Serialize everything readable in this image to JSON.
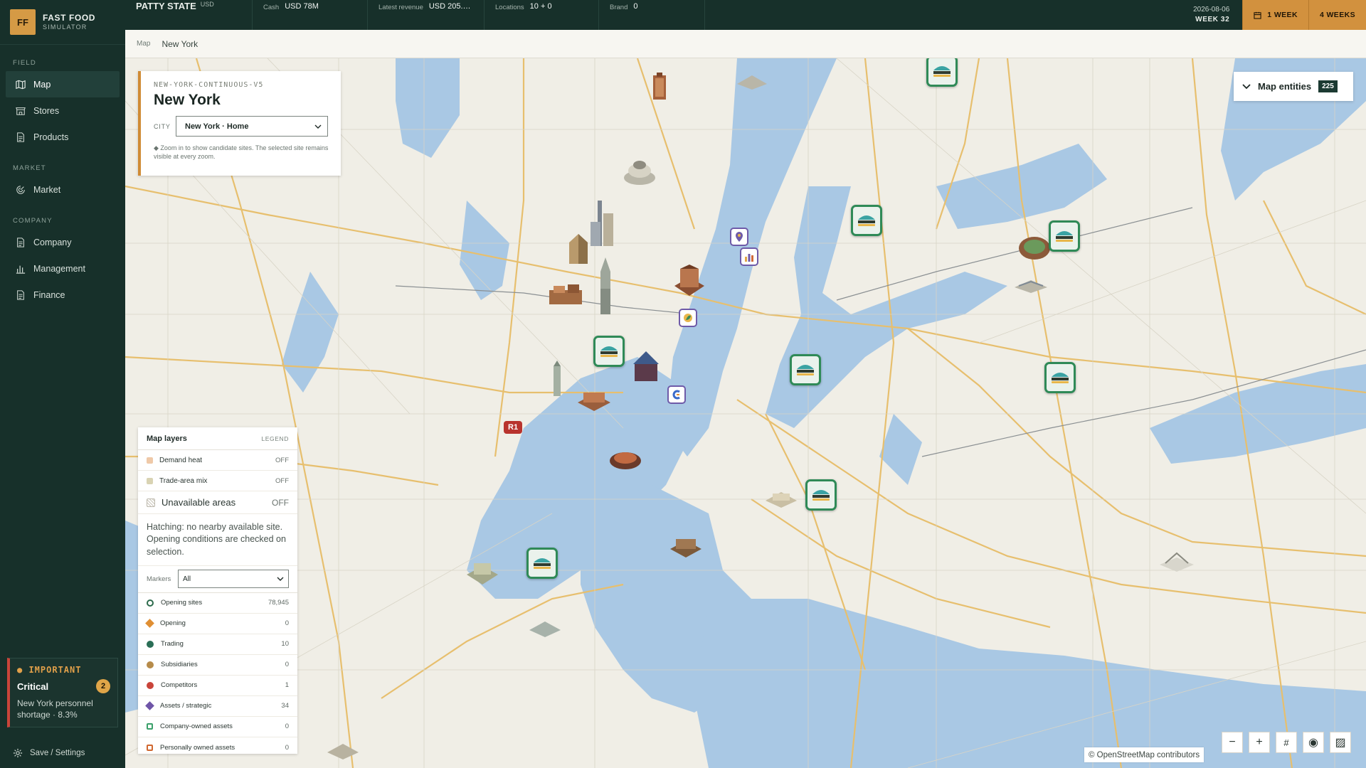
{
  "brand": {
    "logo": "FF",
    "name": "FAST FOOD",
    "sub": "SIMULATOR"
  },
  "sidebar": {
    "sections": [
      {
        "title": "FIELD",
        "items": [
          {
            "label": "Map",
            "icon": "map-icon",
            "active": true
          },
          {
            "label": "Stores",
            "icon": "store-icon"
          },
          {
            "label": "Products",
            "icon": "document-icon"
          }
        ]
      },
      {
        "title": "MARKET",
        "items": [
          {
            "label": "Market",
            "icon": "radar-icon"
          }
        ]
      },
      {
        "title": "COMPANY",
        "items": [
          {
            "label": "Company",
            "icon": "document-icon"
          },
          {
            "label": "Management",
            "icon": "bar-chart-icon"
          },
          {
            "label": "Finance",
            "icon": "document-icon"
          }
        ]
      }
    ],
    "alert": {
      "tag": "IMPORTANT",
      "title": "Critical",
      "count": "2",
      "message": "New York personnel shortage · 8.3%"
    },
    "save_settings": "Save / Settings"
  },
  "topbar": {
    "company": "PATTY STATE",
    "company_unit": "USD",
    "stats": [
      {
        "label": "Cash",
        "value": "USD 78M"
      },
      {
        "label": "Latest revenue",
        "value": "USD 205.…"
      },
      {
        "label": "Locations",
        "value": "10 + 0"
      },
      {
        "label": "Brand",
        "value": "0"
      }
    ],
    "date": "2026-08-06",
    "week": "WEEK 32",
    "btn_1week": "1 WEEK",
    "btn_4weeks": "4 WEEKS"
  },
  "breadcrumb": {
    "root": "Map",
    "current": "New York"
  },
  "city_panel": {
    "code": "NEW-YORK-CONTINUOUS-V5",
    "name": "New York",
    "city_label": "CITY",
    "city_value": "New York · Home",
    "hint": "◆ Zoom in to show candidate sites. The selected site remains visible at every zoom."
  },
  "entities": {
    "label": "Map entities",
    "count": "225"
  },
  "layers": {
    "title": "Map layers",
    "legend": "LEGEND",
    "toggles": [
      {
        "label": "Demand heat",
        "state": "OFF",
        "color": "#efc9a8"
      },
      {
        "label": "Trade-area mix",
        "state": "OFF",
        "color": "#d9d3b3"
      }
    ],
    "unavailable": {
      "label": "Unavailable areas",
      "state": "OFF"
    },
    "hatch_note": "Hatching: no nearby available site. Opening conditions are checked on selection.",
    "markers_label": "Markers",
    "markers_value": "All",
    "marker_rows": [
      {
        "label": "Opening sites",
        "count": "78,945",
        "color": "#ffffff",
        "border": "#2c6b4c"
      },
      {
        "label": "Opening",
        "count": "0",
        "color": "#e08f33",
        "border": "#e08f33"
      },
      {
        "label": "Trading",
        "count": "10",
        "color": "#2a6e56",
        "border": "#2a6e56"
      },
      {
        "label": "Subsidiaries",
        "count": "0",
        "color": "#b68b4a",
        "border": "#b68b4a"
      },
      {
        "label": "Competitors",
        "count": "1",
        "color": "#c9443a",
        "border": "#c9443a"
      },
      {
        "label": "Assets / strategic",
        "count": "34",
        "color": "#6f55a8",
        "border": "#6f55a8"
      },
      {
        "label": "Company-owned assets",
        "count": "0",
        "color": "#3aa06a",
        "border": "#3aa06a"
      },
      {
        "label": "Personally owned assets",
        "count": "0",
        "color": "#d0672f",
        "border": "#d0672f"
      }
    ]
  },
  "map": {
    "road_badge": "R1",
    "attribution": "© OpenStreetMap contributors",
    "water_color": "#a9c8e4",
    "road_color": "#e7bf6e",
    "store_border": "#2f8a57"
  },
  "controls": {
    "zoom_out": "−",
    "zoom_in": "+",
    "grid": "#",
    "locate": "◉",
    "hatch": "▨"
  }
}
